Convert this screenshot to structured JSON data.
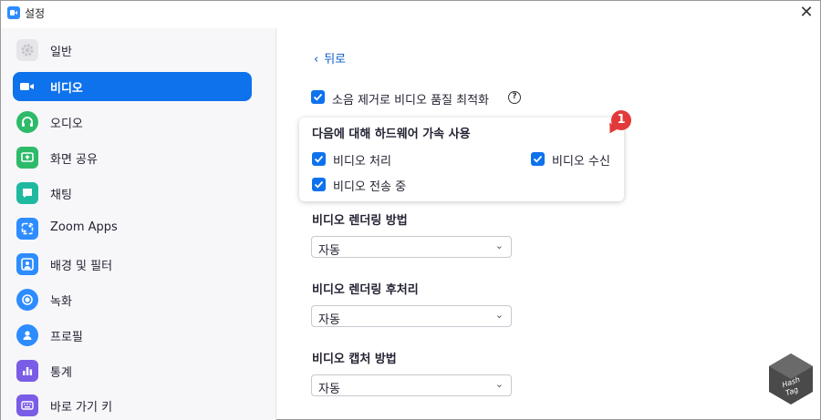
{
  "window": {
    "title": "설정"
  },
  "sidebar": {
    "items": [
      {
        "label": "일반",
        "icon": "gear-icon",
        "color": "#e6e6ea",
        "selected": false
      },
      {
        "label": "비디오",
        "icon": "video-camera-icon",
        "color": "#0e72ed",
        "selected": true
      },
      {
        "label": "오디오",
        "icon": "headphones-icon",
        "color": "#2dbb6a",
        "selected": false
      },
      {
        "label": "화면 공유",
        "icon": "screen-share-icon",
        "color": "#2dbb6a",
        "selected": false
      },
      {
        "label": "채팅",
        "icon": "chat-bubble-icon",
        "color": "#1fb9a0",
        "selected": false
      },
      {
        "label": "Zoom Apps",
        "icon": "apps-icon",
        "color": "#2d8cff",
        "selected": false
      },
      {
        "label": "배경 및 필터",
        "icon": "background-icon",
        "color": "#2d8cff",
        "selected": false
      },
      {
        "label": "녹화",
        "icon": "record-icon",
        "color": "#2d8cff",
        "selected": false
      },
      {
        "label": "프로필",
        "icon": "profile-icon",
        "color": "#2d8cff",
        "selected": false
      },
      {
        "label": "통계",
        "icon": "statistics-icon",
        "color": "#7b5ce6",
        "selected": false
      },
      {
        "label": "바로 가기 키",
        "icon": "keyboard-icon",
        "color": "#7b5ce6",
        "selected": false
      }
    ]
  },
  "content": {
    "back_label": "뒤로",
    "noise_label": "소음 제거로 비디오 품질 최적화",
    "noise_checked": true,
    "hw_accel": {
      "title": "다음에 대해 하드웨어 가속 사용",
      "processing_label": "비디오 처리",
      "receiving_label": "비디오 수신",
      "sending_label": "비디오 전송 중",
      "processing_checked": true,
      "receiving_checked": true,
      "sending_checked": true
    },
    "badge_number": "1",
    "rendering_method": {
      "title": "비디오 렌더링 방법",
      "value": "자동"
    },
    "rendering_post": {
      "title": "비디오 렌더링 후처리",
      "value": "자동"
    },
    "capture_method": {
      "title": "비디오 캡처 방법",
      "value": "자동"
    }
  },
  "colors": {
    "accent": "#0e72ed",
    "badge": "#e23a3a"
  }
}
